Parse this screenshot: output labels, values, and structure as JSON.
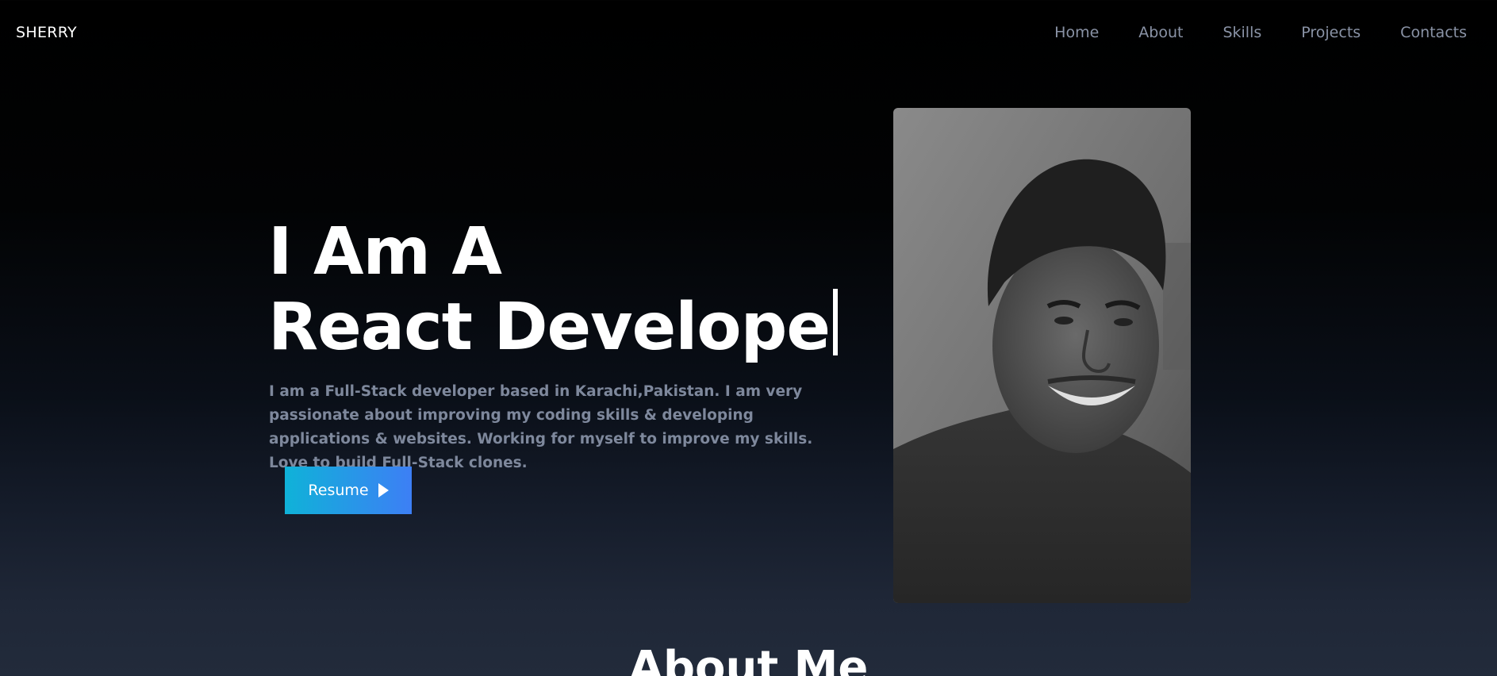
{
  "navbar": {
    "brand": "SHERRY",
    "links": [
      "Home",
      "About",
      "Skills",
      "Projects",
      "Contacts"
    ]
  },
  "hero": {
    "title_line1": "I Am A",
    "title_line2": "React Develope",
    "description": "I am a Full-Stack developer based in Karachi,Pakistan. I am very passionate about improving my coding skills & developing applications & websites. Working for myself to improve my skills. Love to build Full-Stack clones.",
    "resume_label": "Resume"
  },
  "about": {
    "heading": "About Me"
  },
  "colors": {
    "background_top": "#000000",
    "background_bottom": "#222b3b",
    "nav_link": "#8a93a6",
    "description_text": "#7e889c",
    "button_gradient_start": "#0fb2d8",
    "button_gradient_end": "#3d7ff5"
  },
  "icons": {
    "resume_button": "play-icon"
  }
}
